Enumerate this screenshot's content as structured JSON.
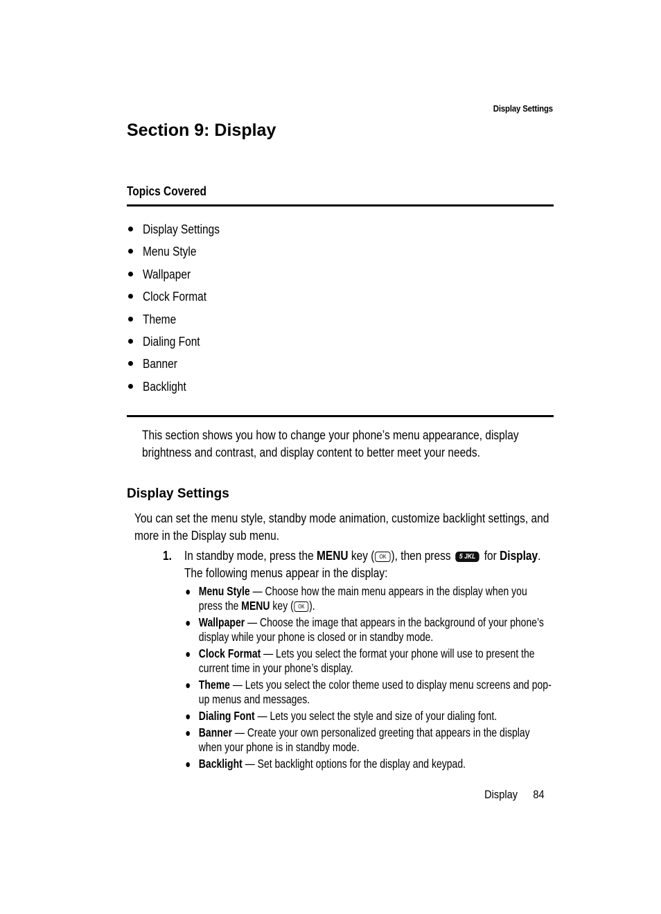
{
  "running_header": "Display Settings",
  "section_title": "Section 9: Display",
  "topics": {
    "heading": "Topics Covered",
    "items": [
      "Display Settings",
      "Menu Style",
      "Wallpaper",
      "Clock Format",
      "Theme",
      "Dialing Font",
      "Banner",
      "Backlight"
    ]
  },
  "intro": "This section shows you how to change your phone’s menu appearance, display brightness and contrast, and display content to better meet your needs.",
  "display_settings": {
    "title": "Display Settings",
    "intro": "You can set the menu style, standby mode animation, customize backlight settings, and more in the Display sub menu.",
    "step": {
      "number": "1.",
      "text_1": "In standby mode, press the ",
      "menu_bold": "MENU",
      "text_2": " key (",
      "ok_key_icon": "OK",
      "text_3": "), then press ",
      "key_5_icon": "5 JKL",
      "text_4": " for ",
      "display_bold": "Display",
      "text_5": ". The following menus appear in the display:"
    },
    "menus": [
      {
        "name": "Menu Style",
        "description": " — Choose how the main menu appears in the display when you press the ",
        "extra_bold": "MENU",
        "extra_text": " key (",
        "ok_icon": "OK",
        "end": ")."
      },
      {
        "name": "Wallpaper",
        "description": " — Choose the image that appears in the background of your phone’s display while your phone is closed or in standby mode."
      },
      {
        "name": "Clock Format",
        "description": " — Lets you select the format your phone will use to present the current time in your phone’s display."
      },
      {
        "name": "Theme",
        "description": " — Lets you select the color theme used to display menu screens and pop-up menus and messages."
      },
      {
        "name": "Dialing Font",
        "description": " — Lets you select the style and size of your dialing font."
      },
      {
        "name": "Banner",
        "description": " — Create your own personalized greeting that appears in the display when your phone is in standby mode."
      },
      {
        "name": "Backlight",
        "description": " — Set backlight options for the display and keypad."
      }
    ]
  },
  "footer": {
    "section": "Display",
    "page": "84"
  }
}
